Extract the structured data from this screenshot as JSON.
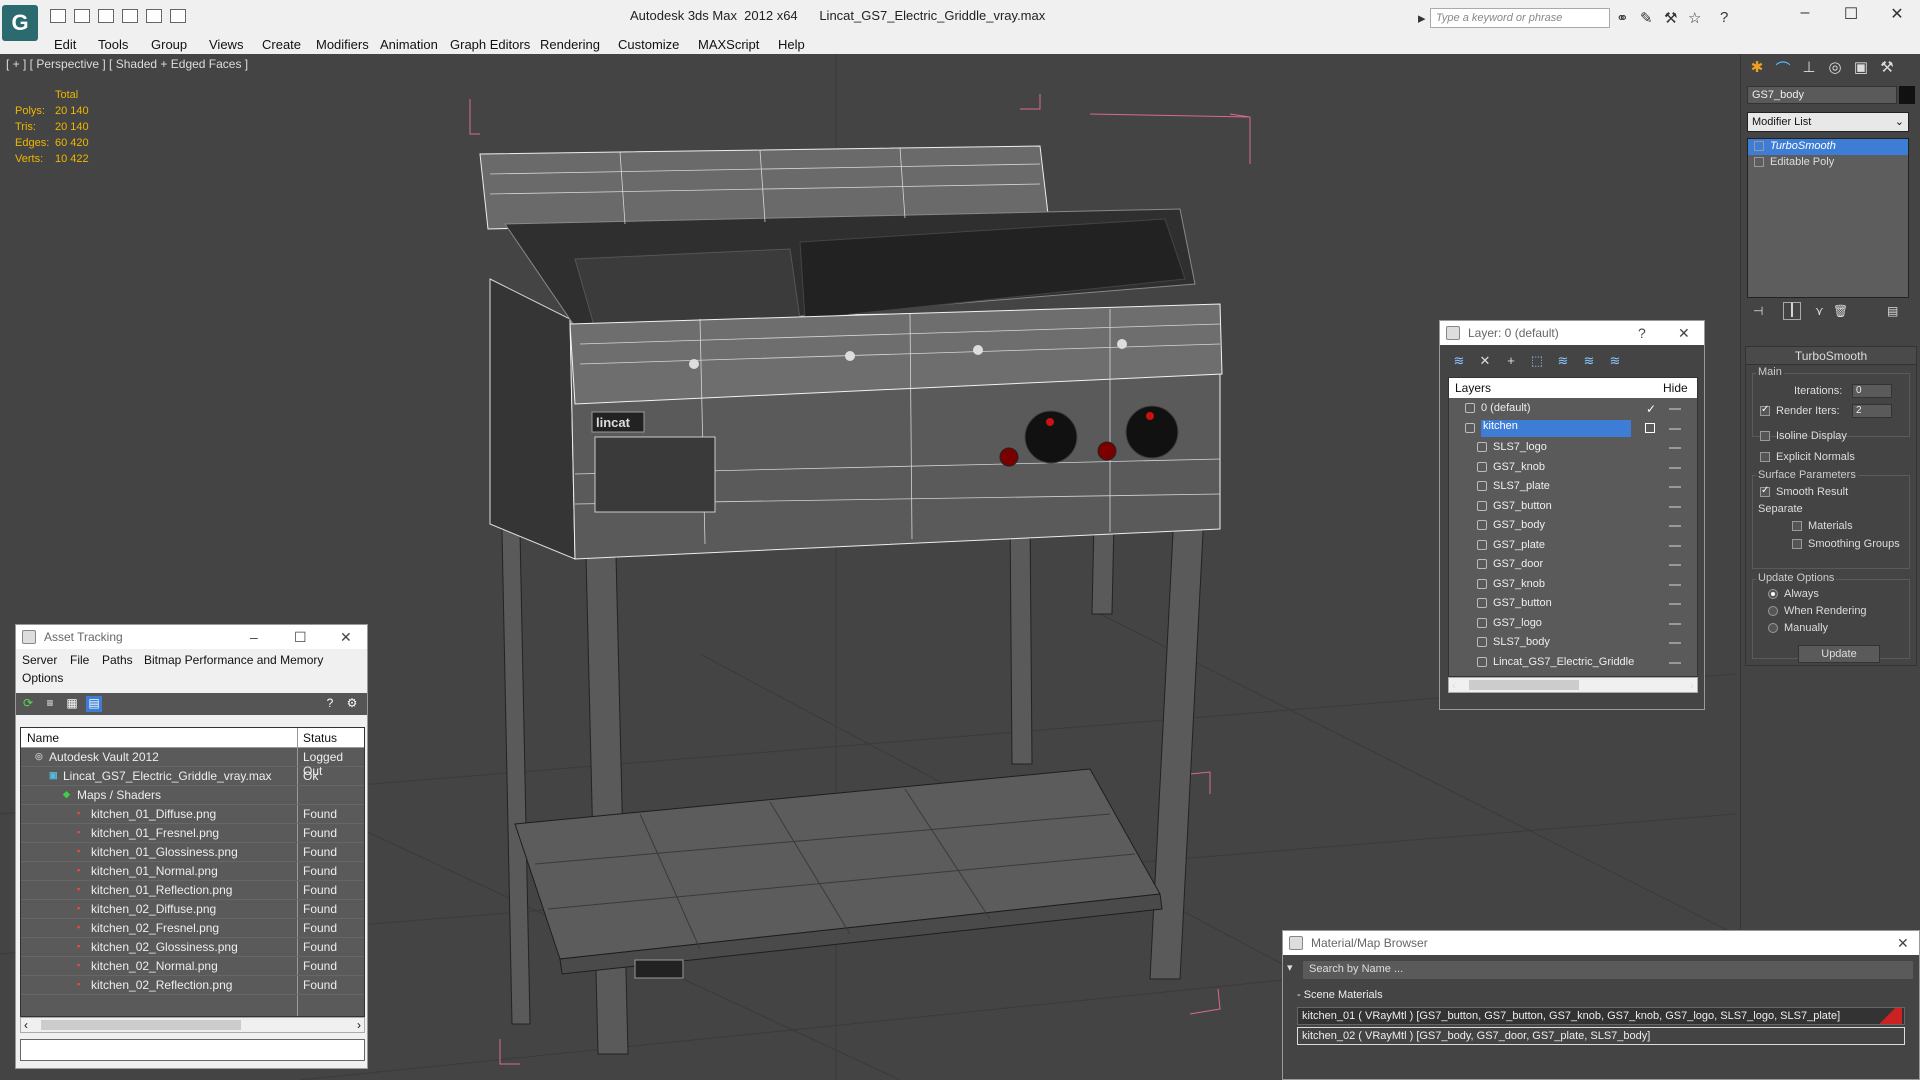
{
  "app": {
    "title": "Autodesk 3ds Max  2012 x64      Lincat_GS7_Electric_Griddle_vray.max",
    "search_placeholder": "Type a keyword or phrase",
    "logo_letter": "G"
  },
  "menu": [
    "Edit",
    "Tools",
    "Group",
    "Views",
    "Create",
    "Modifiers",
    "Animation",
    "Graph Editors",
    "Rendering",
    "Customize",
    "MAXScript",
    "Help"
  ],
  "viewport": {
    "label": "[ + ] [ Perspective ] [ Shaded + Edged Faces ]",
    "stats_header": "Total",
    "stats": [
      {
        "k": "Polys:",
        "v": "20 140"
      },
      {
        "k": "Tris:",
        "v": "20 140"
      },
      {
        "k": "Edges:",
        "v": "60 420"
      },
      {
        "k": "Verts:",
        "v": "10 422"
      }
    ],
    "brand_label": "lincat"
  },
  "command_panel": {
    "object_name": "GS7_body",
    "modifier_list": "Modifier List",
    "stack": [
      "TurboSmooth",
      "Editable Poly"
    ],
    "rollout_title": "TurboSmooth",
    "main_label": "Main",
    "iterations_label": "Iterations:",
    "iterations_value": "0",
    "render_iters_label": "Render Iters:",
    "render_iters_value": "2",
    "isoline_label": "Isoline Display",
    "explicit_normals_label": "Explicit Normals",
    "surface_params_label": "Surface Parameters",
    "smooth_result_label": "Smooth Result",
    "separate_label": "Separate",
    "materials_label": "Materials",
    "smoothing_groups_label": "Smoothing Groups",
    "update_options_label": "Update Options",
    "always_label": "Always",
    "when_rendering_label": "When Rendering",
    "manually_label": "Manually",
    "update_button": "Update"
  },
  "asset_tracking": {
    "title": "Asset Tracking",
    "menu": [
      "Server",
      "File",
      "Paths",
      "Bitmap Performance and Memory",
      "Options"
    ],
    "col_name": "Name",
    "col_status": "Status",
    "rows": [
      {
        "name": "Autodesk Vault 2012",
        "status": "Logged Out",
        "indent": 1,
        "icon": "vault"
      },
      {
        "name": "Lincat_GS7_Electric_Griddle_vray.max",
        "status": "Ok",
        "indent": 2,
        "icon": "max"
      },
      {
        "name": "Maps / Shaders",
        "status": "",
        "indent": 3,
        "icon": "maps"
      },
      {
        "name": "kitchen_01_Diffuse.png",
        "status": "Found",
        "indent": 4,
        "icon": "png"
      },
      {
        "name": "kitchen_01_Fresnel.png",
        "status": "Found",
        "indent": 4,
        "icon": "png"
      },
      {
        "name": "kitchen_01_Glossiness.png",
        "status": "Found",
        "indent": 4,
        "icon": "png"
      },
      {
        "name": "kitchen_01_Normal.png",
        "status": "Found",
        "indent": 4,
        "icon": "png"
      },
      {
        "name": "kitchen_01_Reflection.png",
        "status": "Found",
        "indent": 4,
        "icon": "png"
      },
      {
        "name": "kitchen_02_Diffuse.png",
        "status": "Found",
        "indent": 4,
        "icon": "png"
      },
      {
        "name": "kitchen_02_Fresnel.png",
        "status": "Found",
        "indent": 4,
        "icon": "png"
      },
      {
        "name": "kitchen_02_Glossiness.png",
        "status": "Found",
        "indent": 4,
        "icon": "png"
      },
      {
        "name": "kitchen_02_Normal.png",
        "status": "Found",
        "indent": 4,
        "icon": "png"
      },
      {
        "name": "kitchen_02_Reflection.png",
        "status": "Found",
        "indent": 4,
        "icon": "png"
      }
    ]
  },
  "layer_manager": {
    "title": "Layer: 0 (default)",
    "help": "?",
    "col_layers": "Layers",
    "col_hide": "Hide",
    "rows": [
      {
        "name": "0 (default)",
        "indent": 0,
        "selected": false
      },
      {
        "name": "kitchen",
        "indent": 0,
        "selected": true
      },
      {
        "name": "SLS7_logo",
        "indent": 1,
        "selected": false
      },
      {
        "name": "GS7_knob",
        "indent": 1,
        "selected": false
      },
      {
        "name": "SLS7_plate",
        "indent": 1,
        "selected": false
      },
      {
        "name": "GS7_button",
        "indent": 1,
        "selected": false
      },
      {
        "name": "GS7_body",
        "indent": 1,
        "selected": false
      },
      {
        "name": "GS7_plate",
        "indent": 1,
        "selected": false
      },
      {
        "name": "GS7_door",
        "indent": 1,
        "selected": false
      },
      {
        "name": "GS7_knob",
        "indent": 1,
        "selected": false
      },
      {
        "name": "GS7_button",
        "indent": 1,
        "selected": false
      },
      {
        "name": "GS7_logo",
        "indent": 1,
        "selected": false
      },
      {
        "name": "SLS7_body",
        "indent": 1,
        "selected": false
      },
      {
        "name": "Lincat_GS7_Electric_Griddle",
        "indent": 1,
        "selected": false
      }
    ]
  },
  "material_browser": {
    "title": "Material/Map Browser",
    "search_placeholder": "Search by Name ...",
    "section": "- Scene Materials",
    "materials": [
      "kitchen_01  ( VRayMtl )  [GS7_button, GS7_button, GS7_knob, GS7_knob, GS7_logo, SLS7_logo, SLS7_plate]",
      "kitchen_02  ( VRayMtl )  [GS7_body, GS7_door, GS7_plate, SLS7_body]"
    ]
  },
  "colors": {
    "selection": "#3d7dd6",
    "stats_text": "#eeb700",
    "viewport_bg": "#444444",
    "knob_red": "#cc1111"
  }
}
